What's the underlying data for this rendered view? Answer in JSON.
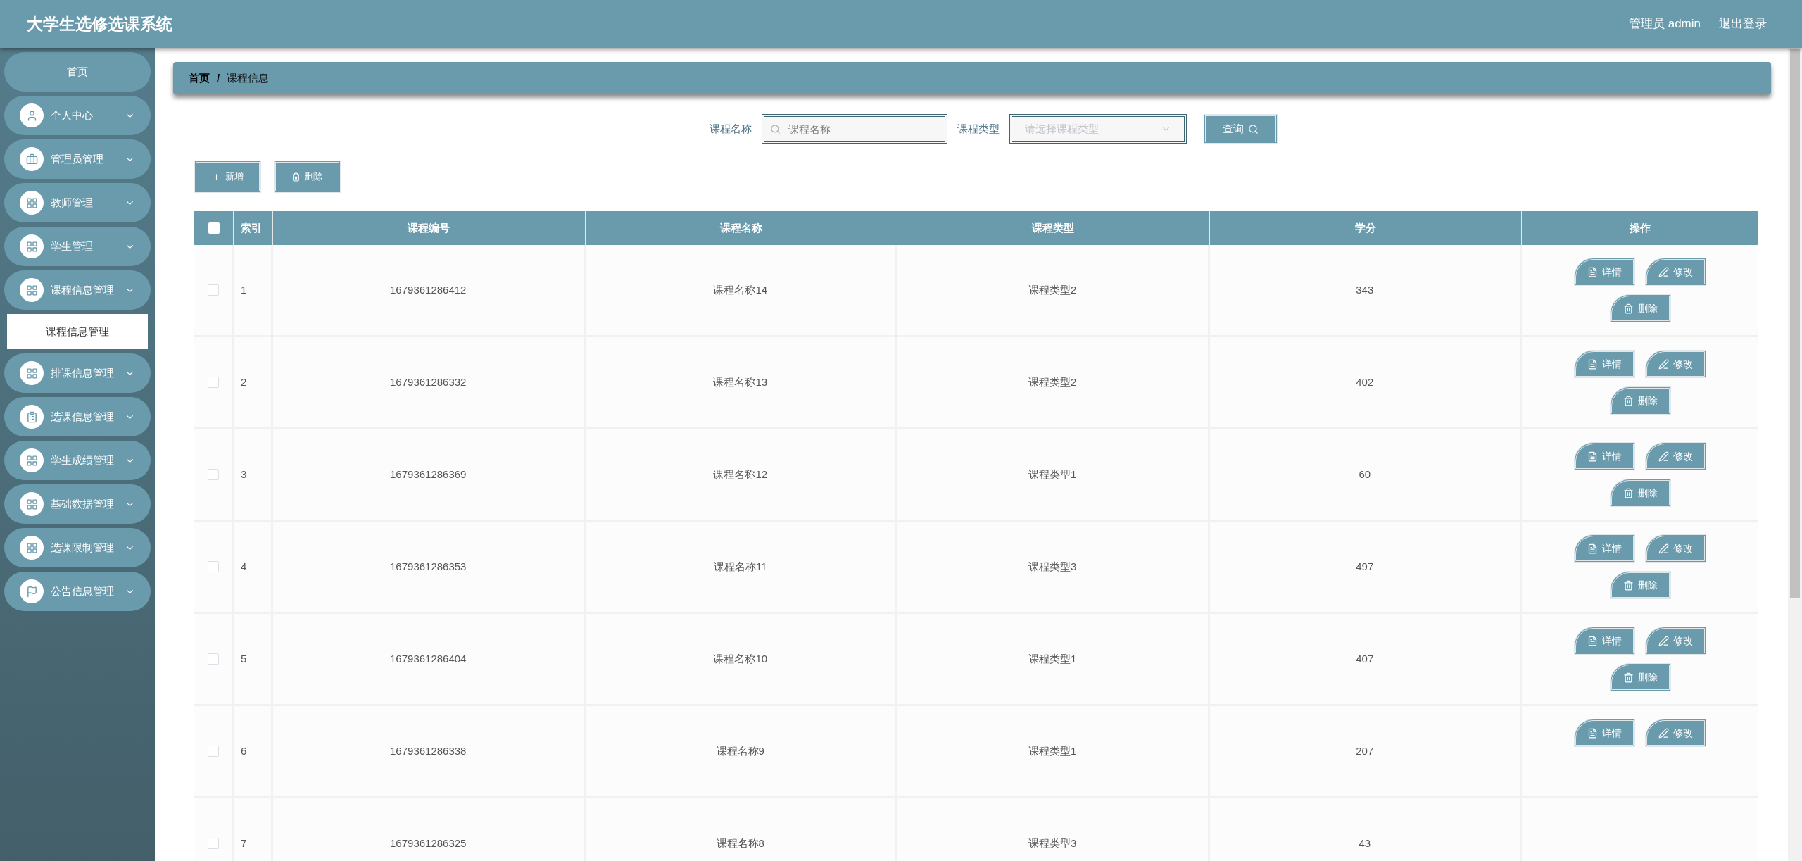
{
  "header": {
    "title": "大学生选修选课系统",
    "user": "管理员 admin",
    "logout": "退出登录"
  },
  "sidebar": {
    "items": [
      {
        "label": "首页"
      },
      {
        "label": "个人中心"
      },
      {
        "label": "管理员管理"
      },
      {
        "label": "教师管理"
      },
      {
        "label": "学生管理"
      },
      {
        "label": "课程信息管理",
        "children": [
          {
            "label": "课程信息管理",
            "selected": true
          }
        ]
      },
      {
        "label": "排课信息管理"
      },
      {
        "label": "选课信息管理"
      },
      {
        "label": "学生成绩管理"
      },
      {
        "label": "基础数据管理"
      },
      {
        "label": "选课限制管理"
      },
      {
        "label": "公告信息管理"
      }
    ]
  },
  "breadcrumb": [
    "首页",
    "/",
    "课程信息"
  ],
  "search": {
    "name_label": "课程名称",
    "name_placeholder": "课程名称",
    "type_label": "课程类型",
    "type_placeholder": "请选择课程类型",
    "submit": "查询"
  },
  "actions": [
    "新增",
    "删除"
  ],
  "table": {
    "select_all_checked": false,
    "columns": [
      "索引",
      "课程编号",
      "课程名称",
      "课程类型",
      "学分",
      "操作"
    ],
    "rows": [
      {
        "index": "1",
        "code": "1679361286412",
        "name": "课程名称14",
        "type": "课程类型2",
        "credit": "343",
        "checked": false,
        "actions": [
          "详情",
          "修改",
          "删除"
        ]
      },
      {
        "index": "2",
        "code": "1679361286332",
        "name": "课程名称13",
        "type": "课程类型2",
        "credit": "402",
        "checked": false,
        "actions": [
          "详情",
          "修改",
          "删除"
        ]
      },
      {
        "index": "3",
        "code": "1679361286369",
        "name": "课程名称12",
        "type": "课程类型1",
        "credit": "60",
        "checked": false,
        "actions": [
          "详情",
          "修改",
          "删除"
        ]
      },
      {
        "index": "4",
        "code": "1679361286353",
        "name": "课程名称11",
        "type": "课程类型3",
        "credit": "497",
        "checked": false,
        "actions": [
          "详情",
          "修改",
          "删除"
        ]
      },
      {
        "index": "5",
        "code": "1679361286404",
        "name": "课程名称10",
        "type": "课程类型1",
        "credit": "407",
        "checked": false,
        "actions": [
          "详情",
          "修改",
          "删除"
        ]
      },
      {
        "index": "6",
        "code": "1679361286338",
        "name": "课程名称9",
        "type": "课程类型1",
        "credit": "207",
        "checked": false,
        "actions": [
          "详情",
          "修改"
        ]
      },
      {
        "index": "7",
        "code": "1679361286325",
        "name": "课程名称8",
        "type": "课程类型3",
        "credit": "43",
        "checked": false
      }
    ]
  }
}
